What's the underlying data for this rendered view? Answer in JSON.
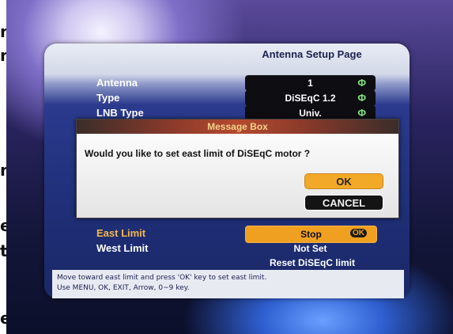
{
  "side_text": {
    "items": [
      "na",
      "n'",
      "n",
      "e",
      "t",
      "e"
    ]
  },
  "panel": {
    "title": "Antenna Setup Page"
  },
  "settings": {
    "antenna": {
      "label": "Antenna",
      "value": "1",
      "icon": "phi"
    },
    "type": {
      "label": "Type",
      "value": "DiSEqC 1.2",
      "icon": "phi"
    },
    "lnb": {
      "label": "LNB Type",
      "value": "Univ.",
      "icon": "phi"
    },
    "east": {
      "label": "East Limit",
      "value": "Stop",
      "icon": "OK"
    },
    "west": {
      "label": "West Limit",
      "value": "Not Set"
    },
    "reset": {
      "label": "Reset DiSEqC limit"
    }
  },
  "message_box": {
    "title": "Message Box",
    "text": "Would you like to set east limit of DiSEqC motor ?",
    "ok_label": "OK",
    "cancel_label": "CANCEL"
  },
  "hint": {
    "line1": "Move toward east limit and press 'OK' key to set east limit.",
    "line2": "Use MENU, OK, EXIT, Arrow, 0~9 key."
  },
  "colors": {
    "accent_orange": "#f0a020",
    "panel_blue": "#20307a",
    "icon_green": "#7fe07f"
  }
}
